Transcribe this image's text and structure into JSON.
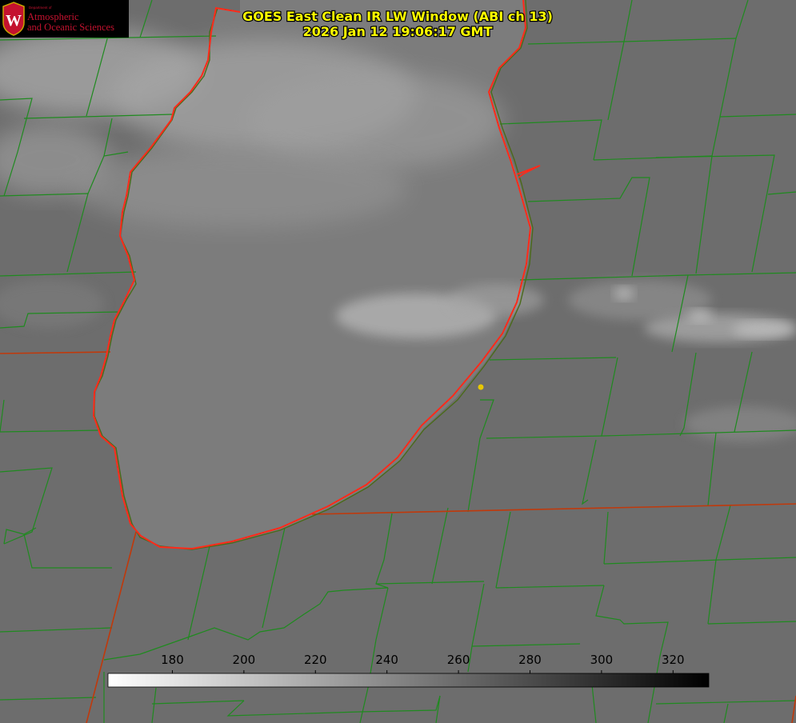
{
  "product": {
    "title_line1": "GOES East Clean IR LW Window (ABI ch 13)",
    "title_line2": "2026 Jan 12 19:06:17 GMT"
  },
  "logo": {
    "seal_letter": "W",
    "department": "Department of",
    "line1": "Atmospheric",
    "line2": "and Oceanic Sciences",
    "brand_color": "#c4122f"
  },
  "colorbar": {
    "vmin": 162,
    "vmax": 330,
    "ticks": [
      {
        "label": "180",
        "value": 180
      },
      {
        "label": "200",
        "value": 200
      },
      {
        "label": "220",
        "value": 220
      },
      {
        "label": "240",
        "value": 240
      },
      {
        "label": "260",
        "value": 260
      },
      {
        "label": "280",
        "value": 280
      },
      {
        "label": "300",
        "value": 300
      },
      {
        "label": "320",
        "value": 320
      }
    ],
    "color_low": "#ffffff",
    "color_high": "#000000"
  },
  "colors": {
    "county_lines": "#1f8a1f",
    "state_lines": "#c0390b",
    "lake_shoreline": "#ff2a1a",
    "station_marker": "#e8c800",
    "title_text": "#ffff00"
  },
  "icons": {
    "seal": "uw-crest-icon",
    "station": "station-dot-icon"
  }
}
